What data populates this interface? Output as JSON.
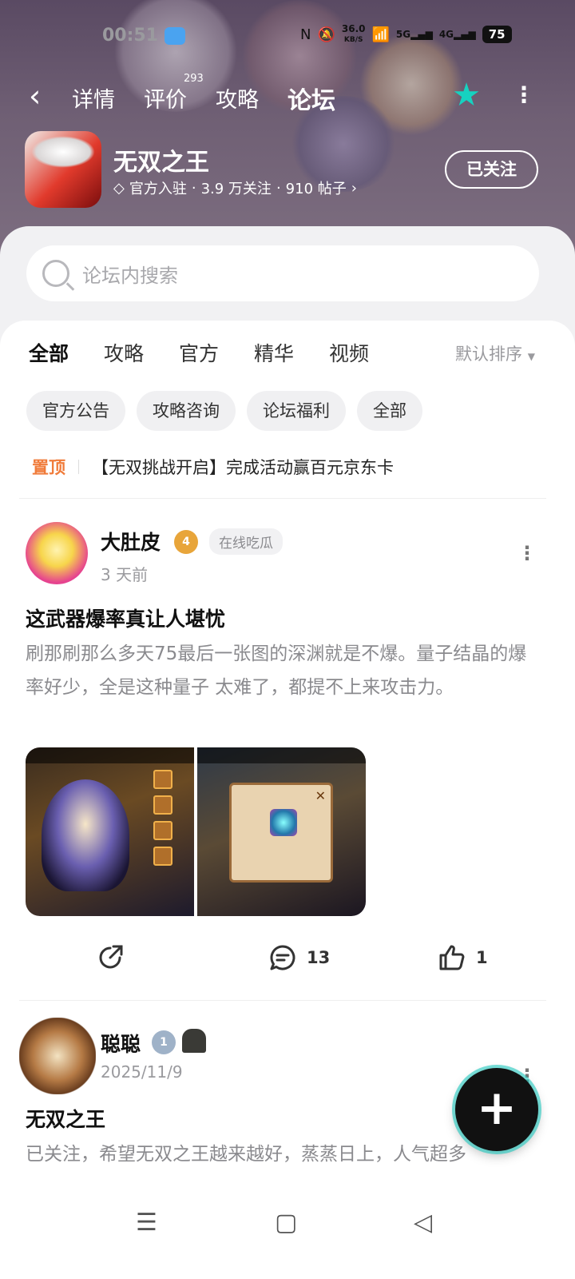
{
  "status_bar": {
    "time": "00:51",
    "net_speed_value": "36.0",
    "net_speed_unit": "KB/S",
    "signal1": "5G",
    "signal2": "4G",
    "battery": "75"
  },
  "nav": {
    "tabs": [
      {
        "label": "详情"
      },
      {
        "label": "评价",
        "count": "293"
      },
      {
        "label": "攻略"
      },
      {
        "label": "论坛",
        "active": true
      }
    ]
  },
  "game": {
    "title": "无双之王",
    "official": "官方入驻",
    "followers": "3.9 万关注",
    "posts": "910 帖子",
    "sep": "·",
    "follow_button": "已关注"
  },
  "search": {
    "placeholder": "论坛内搜索"
  },
  "forum_tabs": [
    "全部",
    "攻略",
    "官方",
    "精华",
    "视频"
  ],
  "sort_label": "默认排序",
  "chips": [
    "官方公告",
    "攻略咨询",
    "论坛福利",
    "全部"
  ],
  "pinned": {
    "tag": "置顶",
    "text": "【无双挑战开启】完成活动赢百元京东卡"
  },
  "posts": [
    {
      "user": "大肚皮",
      "level": "4",
      "badge": "在线吃瓜",
      "time": "3 天前",
      "title": "这武器爆率真让人堪忧",
      "body": "刷那刷那么多天75最后一张图的深渊就是不爆。量子结晶的爆率好少，全是这种量子 太难了，都提不上来攻击力。",
      "comments": "13",
      "likes": "1"
    },
    {
      "user": "聪聪",
      "level": "1",
      "time": "2025/11/9",
      "title": "无双之王",
      "body": "已关注，希望无双之王越来越好，蒸蒸日上，人气超多"
    }
  ],
  "colors": {
    "accent": "#18d3c1",
    "pinned": "#f07b3a"
  }
}
